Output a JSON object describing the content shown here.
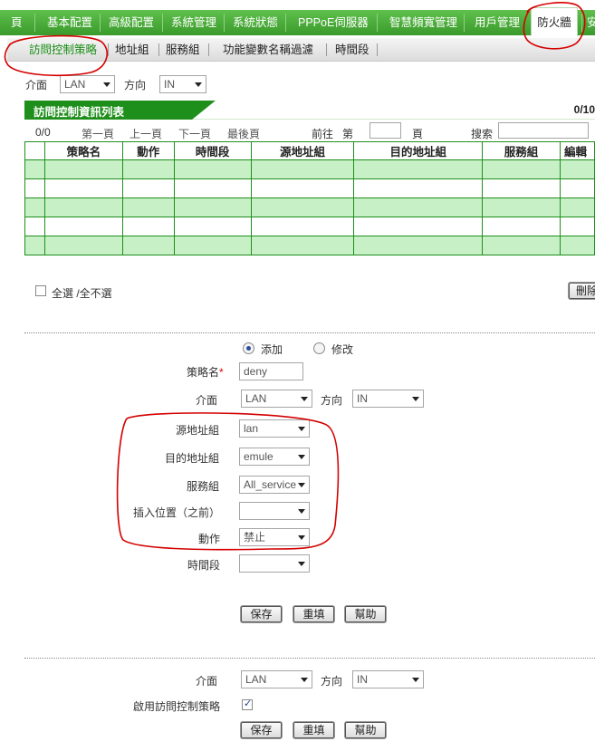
{
  "topnav": {
    "items": [
      "頁",
      "基本配置",
      "高級配置",
      "系統管理",
      "系統狀態",
      "PPPoE伺服器",
      "智慧頻寬管理",
      "用戶管理",
      "防火牆",
      "安"
    ],
    "active": "防火牆"
  },
  "subnav": {
    "items": [
      "訪問控制策略",
      "地址組",
      "服務組",
      "功能變數名稱過濾",
      "時間段"
    ],
    "selected": "訪問控制策略"
  },
  "filter": {
    "interface_label": "介面",
    "interface_value": "LAN",
    "direction_label": "方向",
    "direction_value": "IN"
  },
  "list": {
    "title": "訪問控制資訊列表",
    "count": "0/10",
    "pager": {
      "position": "0/0",
      "first": "第一頁",
      "prev": "上一頁",
      "next": "下一頁",
      "last": "最後頁",
      "goto": "前往",
      "page_prefix": "第",
      "page_suffix": "頁",
      "search_label": "搜索",
      "page_value": "",
      "search_value": ""
    },
    "columns": [
      "策略名",
      "動作",
      "時間段",
      "源地址組",
      "目的地址組",
      "服務組",
      "編輯"
    ],
    "rows": [
      [
        "",
        "",
        "",
        "",
        "",
        "",
        ""
      ],
      [
        "",
        "",
        "",
        "",
        "",
        "",
        ""
      ],
      [
        "",
        "",
        "",
        "",
        "",
        "",
        ""
      ],
      [
        "",
        "",
        "",
        "",
        "",
        "",
        ""
      ],
      [
        "",
        "",
        "",
        "",
        "",
        "",
        ""
      ]
    ]
  },
  "select_all": {
    "label": "全選 /全不選",
    "delete_button": "刪除"
  },
  "form": {
    "mode_add": "添加",
    "mode_edit": "修改",
    "policy_name_label": "策略名",
    "required_mark": "*",
    "policy_name_value": "deny",
    "interface_label": "介面",
    "interface_value": "LAN",
    "direction_label": "方向",
    "direction_value": "IN",
    "src_label": "源地址組",
    "src_value": "lan",
    "dst_label": "目的地址組",
    "dst_value": "emule",
    "service_label": "服務組",
    "service_value": "All_service",
    "insert_label": "插入位置（之前）",
    "insert_value": "",
    "action_label": "動作",
    "action_value": "禁止",
    "time_label": "時間段",
    "time_value": "",
    "save": "保存",
    "reset": "重填",
    "help": "幫助"
  },
  "global": {
    "interface_label": "介面",
    "interface_value": "LAN",
    "direction_label": "方向",
    "direction_value": "IN",
    "enable_label": "啟用訪問控制策略",
    "save": "保存",
    "reset": "重填",
    "help": "幫助"
  },
  "colors": {
    "nav_green": "#3a9a2b",
    "header_green": "#1f8f1c",
    "row_green": "#c7f0c7",
    "annotation_red": "#d40000"
  }
}
